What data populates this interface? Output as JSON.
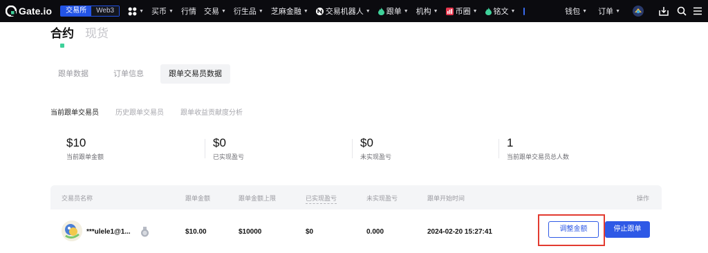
{
  "nav": {
    "logo_text": "Gate.io",
    "env_active": "交易所",
    "env_inactive": "Web3",
    "items": [
      {
        "label": "买币",
        "caret": true
      },
      {
        "label": "行情",
        "caret": false
      },
      {
        "label": "交易",
        "caret": true
      },
      {
        "label": "衍生品",
        "caret": true
      },
      {
        "label": "芝麻金融",
        "caret": true
      },
      {
        "label": "交易机器人",
        "caret": true
      },
      {
        "label": "跟单",
        "caret": true
      },
      {
        "label": "机构",
        "caret": true
      },
      {
        "label": "币圈",
        "caret": true
      },
      {
        "label": "铭文",
        "caret": true
      }
    ],
    "wallet": "钱包",
    "orders": "订单",
    "caret_glyph": "▼"
  },
  "header": {
    "tab_active": "合约",
    "tab_inactive": "现货"
  },
  "subtabs": [
    "跟单数据",
    "订单信息",
    "跟单交易员数据"
  ],
  "subsubtabs": [
    "当前跟单交易员",
    "历史跟单交易员",
    "跟单收益贡献度分析"
  ],
  "stats": [
    {
      "value": "$10",
      "label": "当前跟单金额"
    },
    {
      "value": "$0",
      "label": "已实现盈亏"
    },
    {
      "value": "$0",
      "label": "未实现盈亏"
    },
    {
      "value": "1",
      "label": "当前跟单交易员总人数"
    }
  ],
  "table": {
    "headers": [
      "交易员名称",
      "跟单金额",
      "跟单金额上限",
      "已实现盈亏",
      "未实现盈亏",
      "跟单开始时间",
      "操作"
    ],
    "rows": [
      {
        "trader": "***ulele1@1...",
        "amount": "$10.00",
        "limit": "$10000",
        "realized": "$0",
        "unrealized": "0.000",
        "start_time": "2024-02-20 15:27:41",
        "adjust_label": "调整金额",
        "stop_label": "停止跟单"
      }
    ]
  },
  "colors": {
    "accent": "#2e59e6",
    "highlight": "#e23a2f",
    "nav_bg": "#0b0b0f"
  }
}
